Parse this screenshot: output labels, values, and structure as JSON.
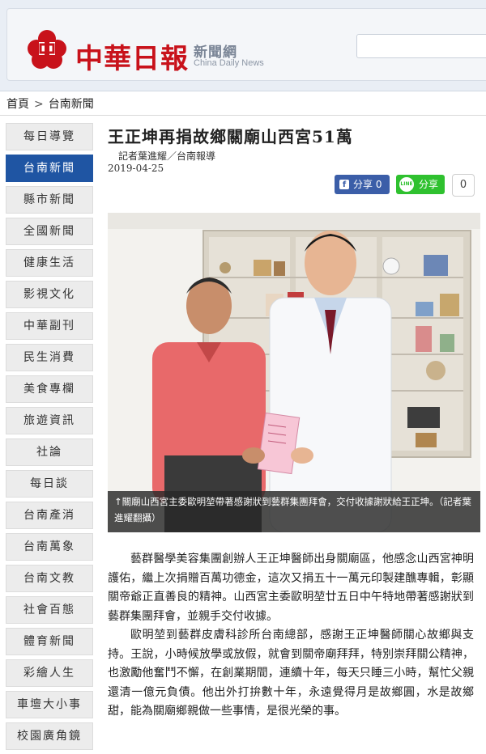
{
  "header": {
    "logo_text": "中華日報",
    "logo_sub": "新聞網",
    "logo_en": "China Daily News"
  },
  "breadcrumb": {
    "home": "首頁",
    "separator": ">",
    "section": "台南新聞"
  },
  "sidebar": {
    "items": [
      {
        "label": "每日導覽",
        "active": false
      },
      {
        "label": "台南新聞",
        "active": true
      },
      {
        "label": "縣市新聞",
        "active": false
      },
      {
        "label": "全國新聞",
        "active": false
      },
      {
        "label": "健康生活",
        "active": false
      },
      {
        "label": "影視文化",
        "active": false
      },
      {
        "label": "中華副刊",
        "active": false
      },
      {
        "label": "民生消費",
        "active": false
      },
      {
        "label": "美食專欄",
        "active": false
      },
      {
        "label": "旅遊資訊",
        "active": false
      },
      {
        "label": "社論",
        "active": false
      },
      {
        "label": "每日談",
        "active": false
      },
      {
        "label": "台南產消",
        "active": false
      },
      {
        "label": "台南萬象",
        "active": false
      },
      {
        "label": "台南文教",
        "active": false
      },
      {
        "label": "社會百態",
        "active": false
      },
      {
        "label": "體育新聞",
        "active": false
      },
      {
        "label": "彩繪人生",
        "active": false
      },
      {
        "label": "車壇大小事",
        "active": false
      },
      {
        "label": "校園廣角鏡",
        "active": false
      }
    ]
  },
  "article": {
    "title": "王正坤再捐故鄉關廟山西宮51萬",
    "byline": "記者葉進耀／台南報導",
    "date": "2019-04-25",
    "share_fb_label": "分享 0",
    "share_line_label": "分享",
    "share_count": "0",
    "photo_caption": "↑關廟山西宮主委歐明堃帶著感謝狀到藝群集團拜會，交付收據謝狀給王正坤。（記者葉進耀翻攝）",
    "paragraphs": [
      "藝群醫學美容集團創辦人王正坤醫師出身關廟區，他感念山西宮神明護佑，繼上次捐贈百萬功德金，這次又捐五十一萬元印製建醮專輯，彰顯關帝爺正直善良的精神。山西宮主委歐明堃廿五日中午特地帶著感謝狀到藝群集團拜會，並親手交付收據。",
      "歐明堃到藝群皮膚科診所台南總部，感謝王正坤醫師關心故鄉與支持。王說，小時候放學或放假，就會到關帝廟拜拜，特別崇拜關公精神，也激勵他奮鬥不懈，在創業期間，連續十年，每天只睡三小時，幫忙父親還清一億元負債。他出外打拚數十年，永遠覺得月是故鄉圓，水是故鄉甜，能為關廟鄉親做一些事情，是很光榮的事。"
    ]
  },
  "colors": {
    "brand_red": "#c8121b",
    "nav_active": "#1f55a3",
    "facebook": "#3b5ea8",
    "line": "#2fc12f"
  }
}
